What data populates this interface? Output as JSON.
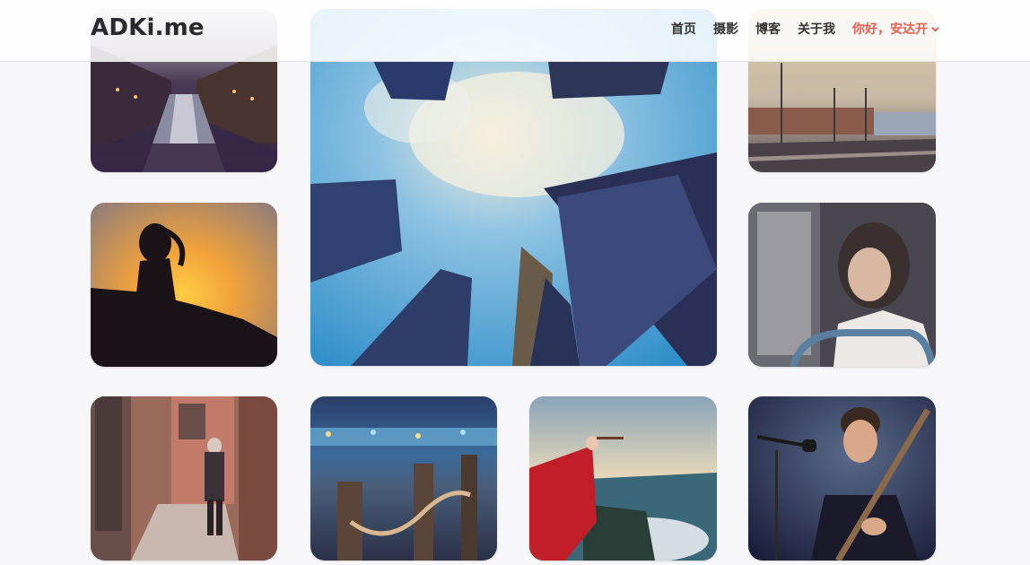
{
  "header": {
    "logo": "ADKi.me",
    "nav": [
      {
        "id": "home",
        "label": "首页"
      },
      {
        "id": "photography",
        "label": "摄影"
      },
      {
        "id": "blog",
        "label": "博客"
      },
      {
        "id": "about",
        "label": "关于我"
      }
    ],
    "user_greeting": "你好，安达开",
    "user_color": "#e95a4f"
  },
  "gallery": {
    "photos": [
      {
        "name": "canal-at-night"
      },
      {
        "name": "skyscrapers-sky"
      },
      {
        "name": "train-station"
      },
      {
        "name": "sunset-silhouette"
      },
      {
        "name": "woman-on-bus"
      },
      {
        "name": "old-man-alley"
      },
      {
        "name": "pier-rope-city"
      },
      {
        "name": "red-dress-violinist"
      },
      {
        "name": "guitar-player"
      }
    ]
  }
}
